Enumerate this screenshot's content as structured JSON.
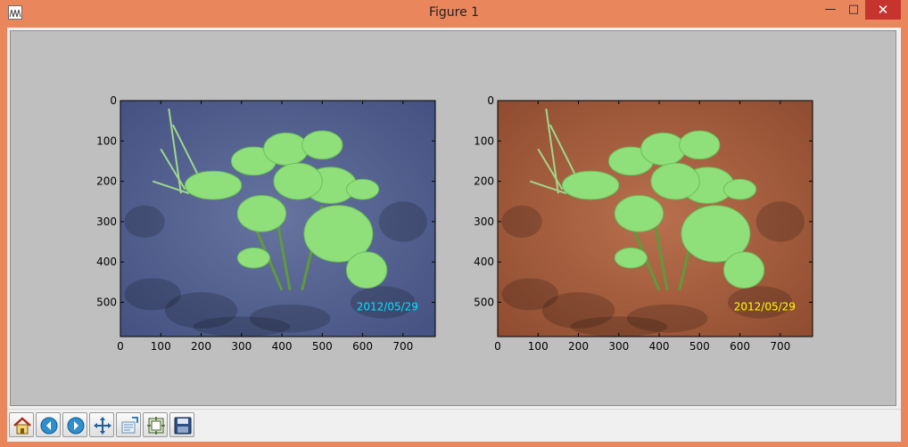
{
  "window": {
    "title": "Figure 1",
    "minimize_glyph": "—",
    "maximize_glyph": "□",
    "close_glyph": "✕"
  },
  "colors": {
    "window_frame": "#e9865c",
    "canvas_bg": "#bfbfbf",
    "date_left": "#00e5ff",
    "date_right": "#ffff00"
  },
  "figure": {
    "subplots": [
      {
        "name": "left-image",
        "x_ticks": [
          "0",
          "100",
          "200",
          "300",
          "400",
          "500",
          "600",
          "700"
        ],
        "y_ticks": [
          "0",
          "100",
          "200",
          "300",
          "400",
          "500"
        ],
        "xlim": [
          0,
          780
        ],
        "ylim": [
          585,
          0
        ],
        "date_stamp": "2012/05/29",
        "soil_color": "#4e5d93"
      },
      {
        "name": "right-image",
        "x_ticks": [
          "0",
          "100",
          "200",
          "300",
          "400",
          "500",
          "600",
          "700"
        ],
        "y_ticks": [
          "0",
          "100",
          "200",
          "300",
          "400",
          "500"
        ],
        "xlim": [
          0,
          780
        ],
        "ylim": [
          585,
          0
        ],
        "date_stamp": "2012/05/29",
        "soil_color": "#a35a3b"
      }
    ]
  },
  "toolbar": {
    "items": [
      {
        "icon": "home-icon"
      },
      {
        "icon": "back-arrow-icon"
      },
      {
        "icon": "forward-arrow-icon"
      },
      {
        "icon": "pan-icon"
      },
      {
        "icon": "zoom-rect-icon"
      },
      {
        "icon": "subplots-config-icon"
      },
      {
        "icon": "save-icon"
      }
    ]
  }
}
